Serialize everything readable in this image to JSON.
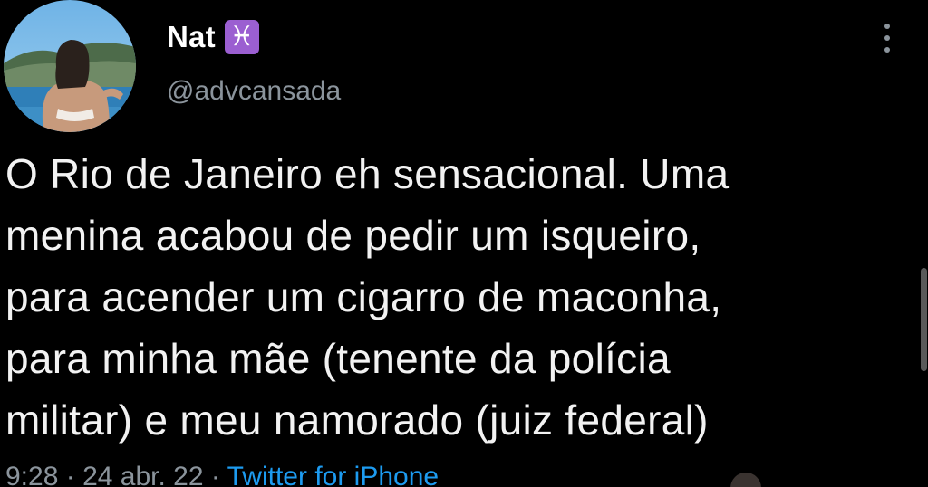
{
  "tweet": {
    "author": {
      "display_name": "Nat",
      "name_emoji": "♓",
      "name_emoji_icon": "pisces-icon",
      "handle": "@advcansada",
      "avatar_icon": "profile-photo"
    },
    "text": "O Rio de Janeiro eh sensacional. Uma\nmenina acabou de pedir um isqueiro,\npara acender um cigarro de maconha,\npara minha mãe (tenente da polícia\nmilitar) e meu namorado (juiz federal)",
    "meta": {
      "time": "9:28",
      "separator": " · ",
      "date": "24 abr. 22",
      "source": "Twitter for iPhone"
    },
    "more_icon": "more-vertical-icon"
  },
  "colors": {
    "background": "#000000",
    "text": "#f2f2f2",
    "secondary": "#8b949c",
    "link": "#1d9bf0",
    "emoji_bg": "#9b5fd1"
  }
}
